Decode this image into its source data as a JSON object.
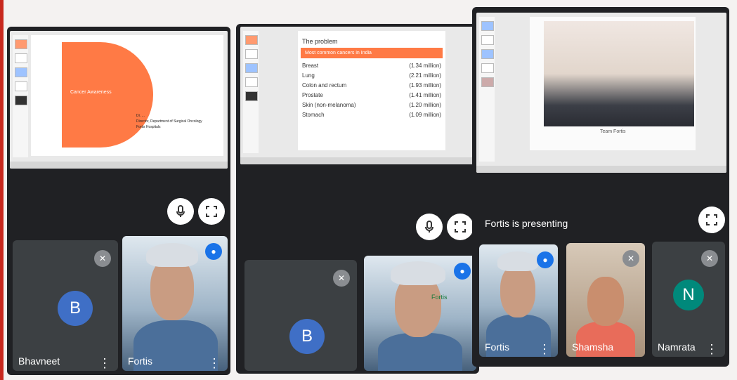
{
  "panel1": {
    "slide": {
      "title": "Cancer Awareness",
      "presenter_lines": [
        "Dr. ...",
        "Director, Department of Surgical Oncology",
        "Fortis Hospitals"
      ]
    },
    "participants": [
      {
        "name": "Bhavneet",
        "initial": "B"
      },
      {
        "name": "Fortis"
      }
    ]
  },
  "panel2": {
    "slide": {
      "title": "The problem",
      "highlight": "Most common cancers in India",
      "rows": [
        {
          "label": "Breast",
          "value": "(1.34 million)"
        },
        {
          "label": "Lung",
          "value": "(2.21 million)"
        },
        {
          "label": "Colon and rectum",
          "value": "(1.93 million)"
        },
        {
          "label": "Prostate",
          "value": "(1.41 million)"
        },
        {
          "label": "Skin (non-melanoma)",
          "value": "(1.20 million)"
        },
        {
          "label": "Stomach",
          "value": "(1.09 million)"
        }
      ]
    },
    "participants": [
      {
        "initial": "B"
      },
      {
        "name": "Fortis"
      }
    ]
  },
  "panel3": {
    "slide": {
      "caption": "Team Fortis"
    },
    "presenting_text": "Fortis is presenting",
    "participants": [
      {
        "name": "Fortis"
      },
      {
        "name": "Shamsha"
      },
      {
        "name": "Namrata",
        "initial": "N"
      }
    ]
  },
  "colors": {
    "avatar_b": "#3f6fc6",
    "avatar_n": "#00897b",
    "meet_dark": "#202124",
    "slide_orange": "#ff7a45"
  }
}
